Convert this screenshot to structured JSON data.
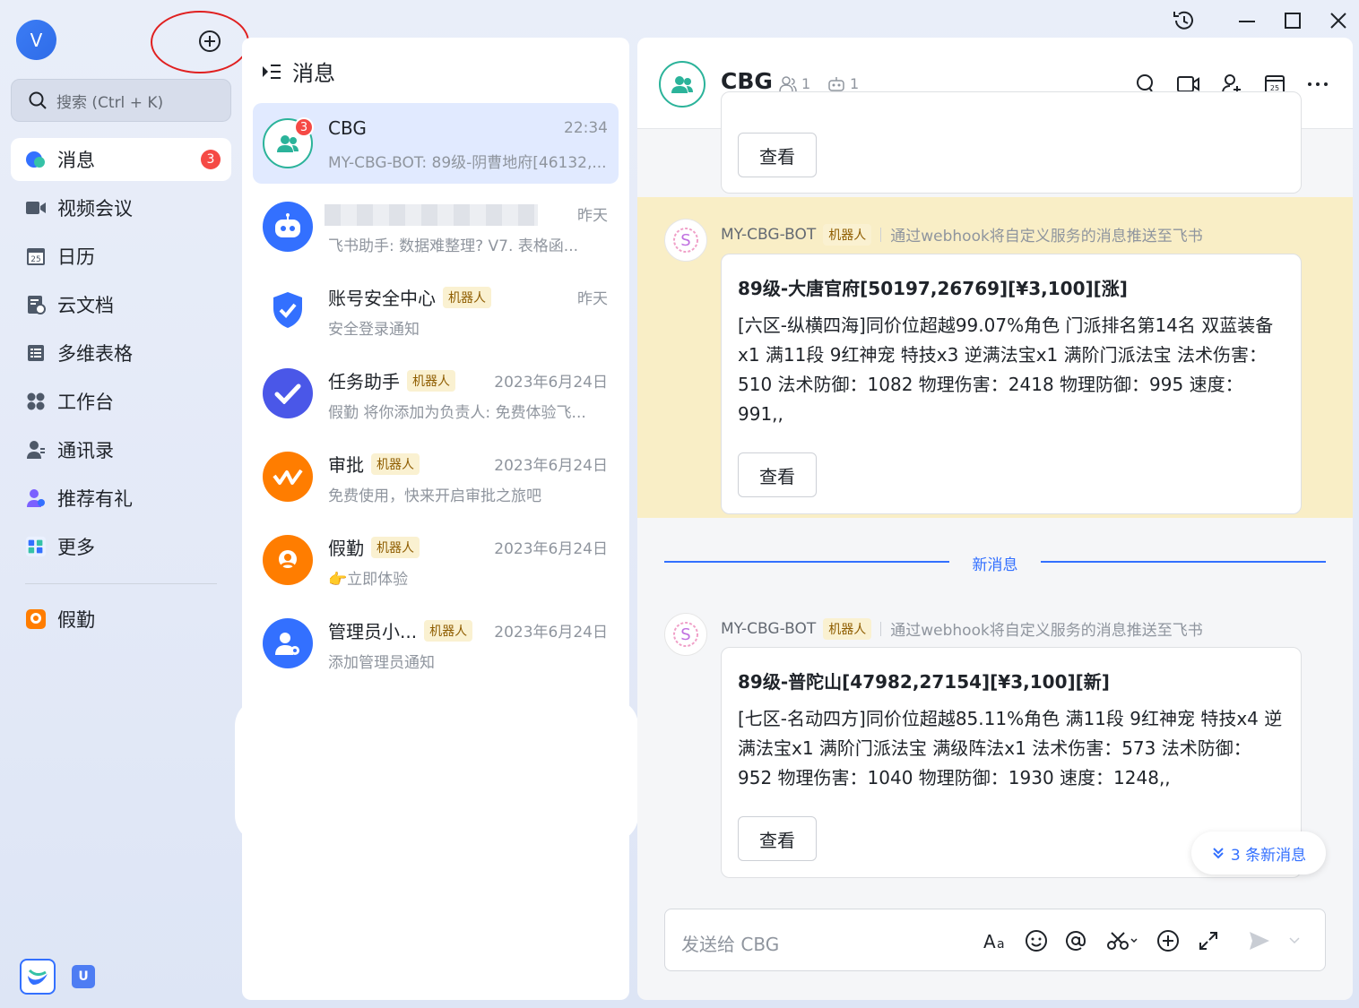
{
  "user": {
    "avatar_letter": "V"
  },
  "search": {
    "placeholder": "搜索 (Ctrl + K)"
  },
  "sidebar": {
    "items": [
      {
        "label": "消息",
        "badge": "3"
      },
      {
        "label": "视频会议"
      },
      {
        "label": "日历",
        "icon_text": "25"
      },
      {
        "label": "云文档"
      },
      {
        "label": "多维表格"
      },
      {
        "label": "工作台"
      },
      {
        "label": "通讯录"
      },
      {
        "label": "推荐有礼"
      },
      {
        "label": "更多"
      },
      {
        "label": "假勤"
      }
    ],
    "bottom_app_letter": "U"
  },
  "chat_list": {
    "title": "消息",
    "chats": [
      {
        "name": "CBG",
        "time": "22:34",
        "preview": "MY-CBG-BOT: 89级-阴曹地府[46132,...",
        "badge": "3"
      },
      {
        "name": "",
        "time": "昨天",
        "preview": "飞书助手: 数据难整理? V7.   表格函..."
      },
      {
        "name": "账号安全中心",
        "tag": "机器人",
        "time": "昨天",
        "preview": "安全登录通知"
      },
      {
        "name": "任务助手",
        "tag": "机器人",
        "time": "2023年6月24日",
        "preview": "假勤 将你添加为负责人: 免费体验飞..."
      },
      {
        "name": "审批",
        "tag": "机器人",
        "time": "2023年6月24日",
        "preview": "免费使用，快来开启审批之旅吧"
      },
      {
        "name": "假勤",
        "tag": "机器人",
        "time": "2023年6月24日",
        "preview": "👉立即体验"
      },
      {
        "name": "管理员小...",
        "tag": "机器人",
        "time": "2023年6月24日",
        "preview": "添加管理员通知"
      }
    ]
  },
  "conversation": {
    "title": "CBG",
    "member_count": "1",
    "bot_count": "1",
    "view_label": "查看",
    "messages": [
      {
        "sender": "MY-CBG-BOT",
        "tag": "机器人",
        "desc": "通过webhook将自定义服务的消息推送至飞书",
        "title": "89级-大唐官府[50197,26769][¥3,100][涨]",
        "body": "[六区-纵横四海]同价位超越99.07%角色 门派排名第14名 双蓝装备x1 满11段 9红神宠 特技x3 逆满法宝x1 满阶门派法宝 法术伤害：510 法术防御：1082 物理伤害：2418 物理防御：995 速度：991,,"
      },
      {
        "sender": "MY-CBG-BOT",
        "tag": "机器人",
        "desc": "通过webhook将自定义服务的消息推送至飞书",
        "title": "89级-普陀山[47982,27154][¥3,100][新]",
        "body": "[七区-名动四方]同价位超越85.11%角色 满11段 9红神宠 特技x4 逆满法宝x1 满阶门派法宝 满级阵法x1 法术伤害：573 法术防御：952 物理伤害：1040 物理防御：1930 速度：1248,,"
      }
    ],
    "new_divider": "新消息",
    "new_pill": "3 条新消息",
    "input_placeholder": "发送给 CBG"
  },
  "colors": {
    "accent": "#3370ff",
    "badge": "#f54a45",
    "highlight": "#f9eec6",
    "group_teal": "#2bb39a"
  }
}
